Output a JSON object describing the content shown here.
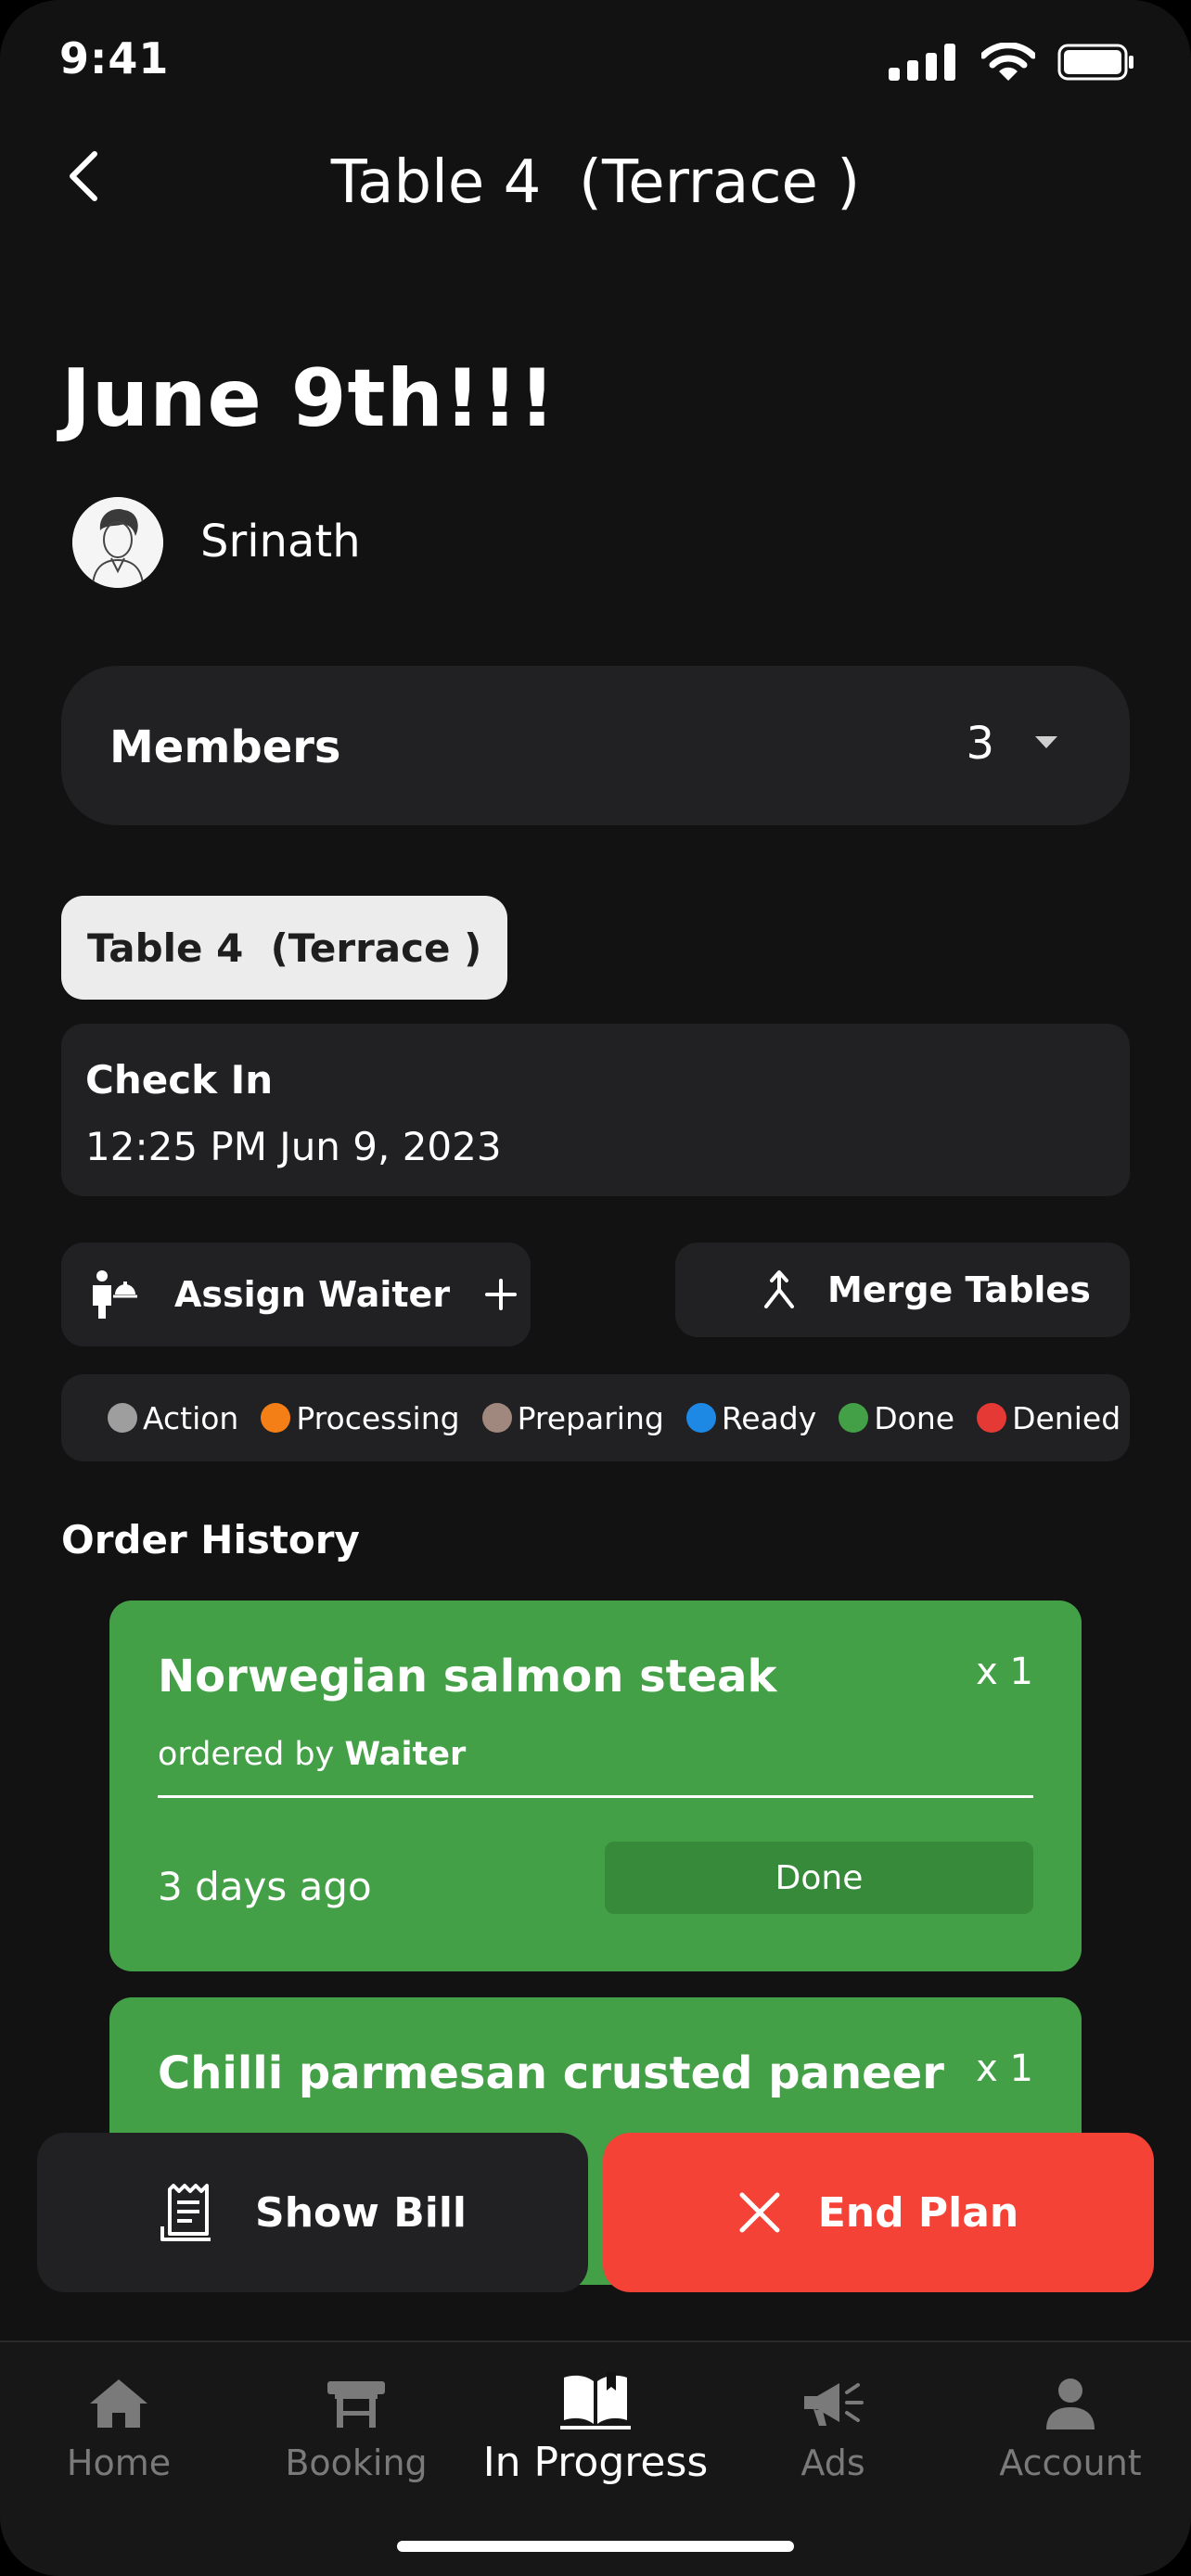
{
  "status_bar": {
    "time": "9:41"
  },
  "header": {
    "title": "Table 4  (Terrace )"
  },
  "event": {
    "title": "June 9th!!!",
    "host_name": "Srinath"
  },
  "members": {
    "label": "Members",
    "count": "3"
  },
  "table_chip": {
    "label": "Table 4  (Terrace )"
  },
  "check_in": {
    "label": "Check In",
    "value": "12:25 PM Jun 9, 2023"
  },
  "actions": {
    "assign_waiter": "Assign Waiter",
    "merge_tables": "Merge Tables"
  },
  "legend": {
    "items": [
      {
        "label": "Action",
        "color": "#9e9e9e"
      },
      {
        "label": "Processing",
        "color": "#f57f17"
      },
      {
        "label": "Preparing",
        "color": "#a1887f"
      },
      {
        "label": "Ready",
        "color": "#1e88e5"
      },
      {
        "label": "Done",
        "color": "#43a047"
      },
      {
        "label": "Denied",
        "color": "#e53935"
      }
    ]
  },
  "order_history": {
    "title": "Order History",
    "orders": [
      {
        "name": "Norwegian salmon steak",
        "qty": "x 1",
        "ordered_by_prefix": "ordered by",
        "ordered_by": "Waiter",
        "time": "3 days ago",
        "status": "Done"
      },
      {
        "name": "Chilli parmesan crusted paneer",
        "qty": "x 1"
      }
    ]
  },
  "bottom_actions": {
    "show_bill": "Show Bill",
    "end_plan": "End Plan"
  },
  "tab_bar": {
    "tabs": [
      {
        "label": "Home",
        "icon": "home-icon"
      },
      {
        "label": "Booking",
        "icon": "table-icon"
      },
      {
        "label": "In Progress",
        "icon": "book-icon"
      },
      {
        "label": "Ads",
        "icon": "megaphone-icon"
      },
      {
        "label": "Account",
        "icon": "person-icon"
      }
    ],
    "active": "In Progress"
  }
}
